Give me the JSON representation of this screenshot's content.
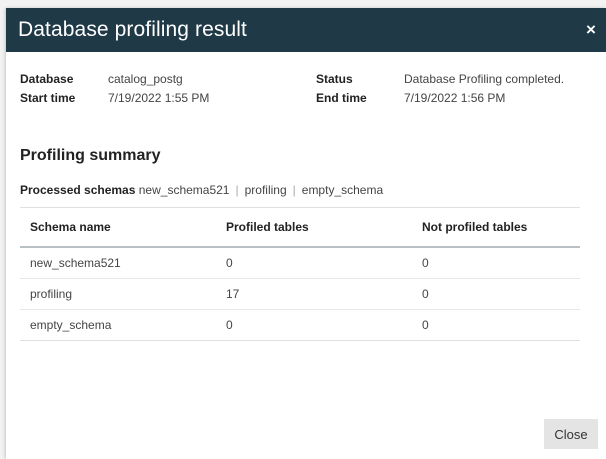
{
  "dialog": {
    "title": "Database profiling result",
    "close_glyph": "×"
  },
  "meta": {
    "database_label": "Database",
    "database_value": "catalog_postg",
    "status_label": "Status",
    "status_value": "Database Profiling completed.",
    "start_label": "Start time",
    "start_value": "7/19/2022 1:55 PM",
    "end_label": "End time",
    "end_value": "7/19/2022 1:56 PM"
  },
  "summary": {
    "title": "Profiling summary",
    "processed_label": "Processed schemas",
    "processed_schemas": [
      "new_schema521",
      "profiling",
      "empty_schema"
    ],
    "separator": "|",
    "columns": [
      "Schema name",
      "Profiled tables",
      "Not profiled tables"
    ],
    "rows": [
      [
        "new_schema521",
        "0",
        "0"
      ],
      [
        "profiling",
        "17",
        "0"
      ],
      [
        "empty_schema",
        "0",
        "0"
      ]
    ]
  },
  "footer": {
    "close_label": "Close"
  }
}
